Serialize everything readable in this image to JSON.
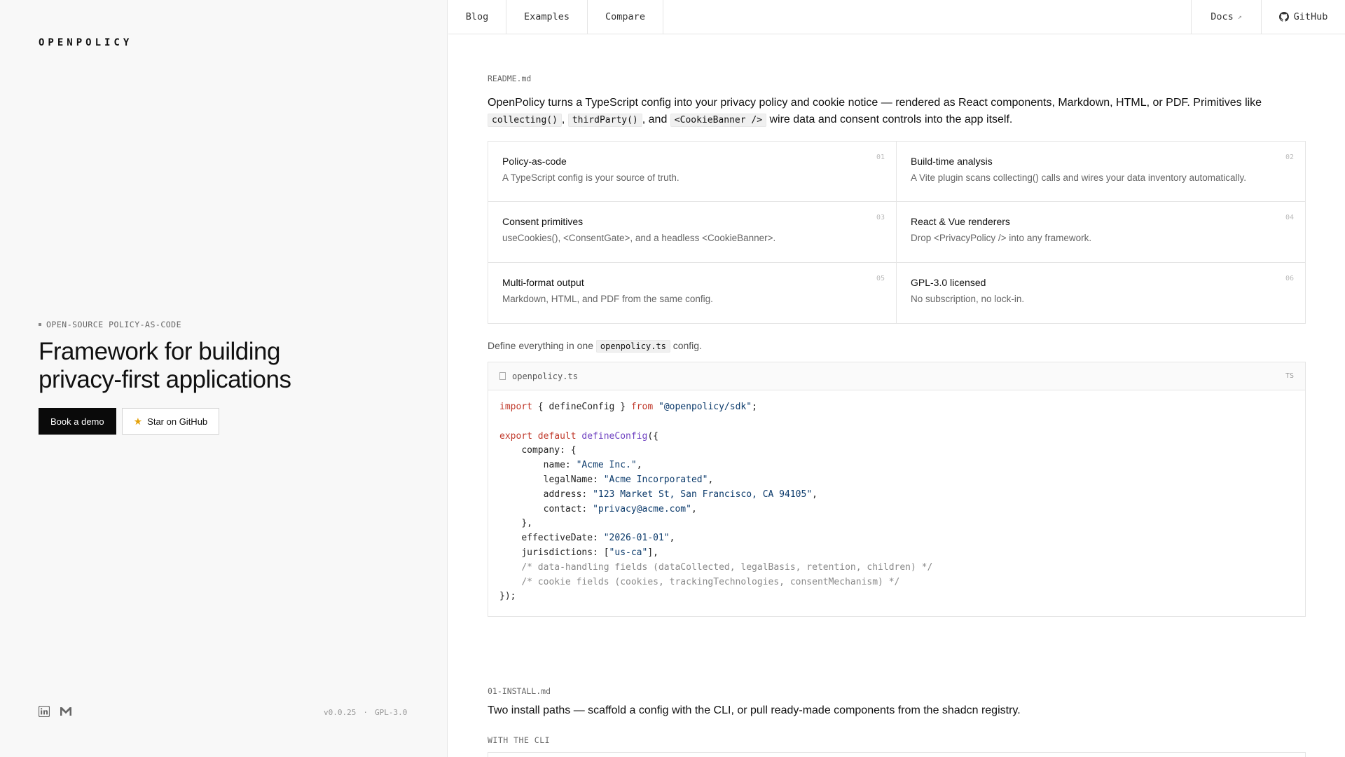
{
  "brand": {
    "logo": "OPENPOLICY"
  },
  "hero": {
    "eyebrow": "OPEN-SOURCE POLICY-AS-CODE",
    "headline_line1": "Framework for building",
    "headline_line2": "privacy-first applications",
    "primary_button": "Book a demo",
    "secondary_button": "Star on GitHub"
  },
  "footer_left": {
    "version": "v0.0.25",
    "separator": "·",
    "license": "GPL-3.0"
  },
  "nav": {
    "blog": "Blog",
    "examples": "Examples",
    "compare": "Compare",
    "docs": "Docs",
    "github": "GitHub"
  },
  "readme": {
    "file": "README.md",
    "intro_1": "OpenPolicy turns a TypeScript config into your privacy policy and cookie notice — rendered as React components, Markdown, HTML, or PDF. Primitives like",
    "code_1": "collecting()",
    "sep_1": ",",
    "code_2": "thirdParty()",
    "sep_2": ", and",
    "code_3": "<CookieBanner />",
    "intro_2": "wire data and consent controls into the app itself."
  },
  "features": [
    {
      "title": "Policy-as-code",
      "desc": "A TypeScript config is your source of truth.",
      "num": "01"
    },
    {
      "title": "Build-time analysis",
      "desc": "A Vite plugin scans collecting() calls and wires your data inventory automatically.",
      "num": "02"
    },
    {
      "title": "Consent primitives",
      "desc": "useCookies(), <ConsentGate>, and a headless <CookieBanner>.",
      "num": "03"
    },
    {
      "title": "React & Vue renderers",
      "desc": "Drop <PrivacyPolicy /> into any framework.",
      "num": "04"
    },
    {
      "title": "Multi-format output",
      "desc": "Markdown, HTML, and PDF from the same config.",
      "num": "05"
    },
    {
      "title": "GPL-3.0 licensed",
      "desc": "No subscription, no lock-in.",
      "num": "06"
    }
  ],
  "define": {
    "before": "Define everything in one",
    "file": "openpolicy.ts",
    "after": "config."
  },
  "code_block": {
    "filename": "openpolicy.ts",
    "lang": "TS",
    "import_kw": "import",
    "import_names": " { defineConfig } ",
    "from_kw": "from",
    "import_src": "\"@openpolicy/sdk\"",
    "export_kw": "export default",
    "define_fn": "defineConfig",
    "company_key": "company: {",
    "name_key": "name: ",
    "name_val": "\"Acme Inc.\"",
    "legal_key": "legalName: ",
    "legal_val": "\"Acme Incorporated\"",
    "address_key": "address: ",
    "address_val": "\"123 Market St, San Francisco, CA 94105\"",
    "contact_key": "contact: ",
    "contact_val": "\"privacy@acme.com\"",
    "close_company": "},",
    "eff_key": "effectiveDate: ",
    "eff_val": "\"2026-01-01\"",
    "jur_key": "jurisdictions: [",
    "jur_val": "\"us-ca\"",
    "comment_1": "/* data-handling fields (dataCollected, legalBasis, retention, children) */",
    "comment_2": "/* cookie fields (cookies, trackingTechnologies, consentMechanism) */",
    "close_all": "});"
  },
  "install": {
    "file": "01-INSTALL.md",
    "title": "Two install paths — scaffold a config with the CLI, or pull ready-made components from the shadcn registry.",
    "sub": "WITH THE CLI"
  }
}
